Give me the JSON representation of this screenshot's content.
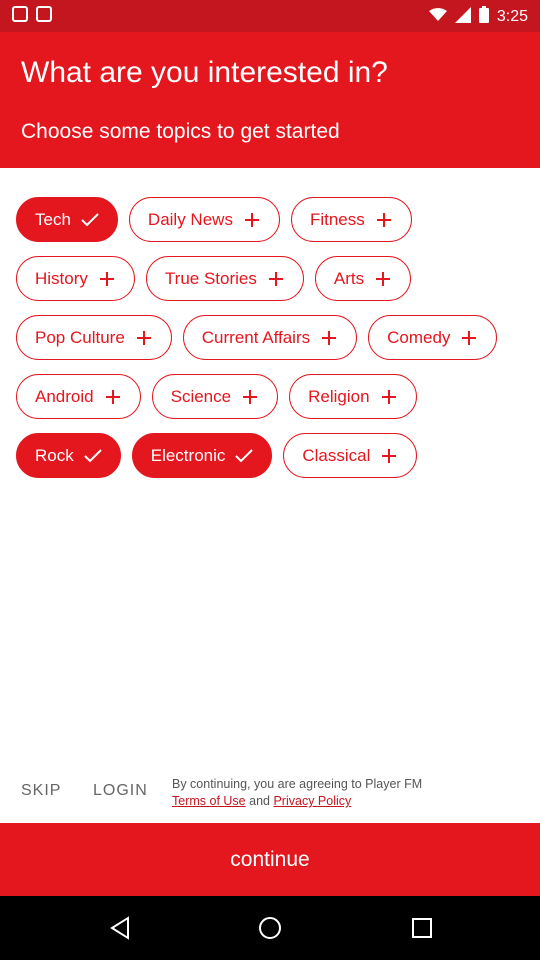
{
  "status": {
    "time": "3:25"
  },
  "header": {
    "title": "What are you interested in?",
    "subtitle": "Choose some topics to get started"
  },
  "topics": [
    [
      {
        "label": "Tech",
        "selected": true
      },
      {
        "label": "Daily News",
        "selected": false
      },
      {
        "label": "Fitness",
        "selected": false
      }
    ],
    [
      {
        "label": "History",
        "selected": false
      },
      {
        "label": "True Stories",
        "selected": false
      },
      {
        "label": "Arts",
        "selected": false
      }
    ],
    [
      {
        "label": "Pop Culture",
        "selected": false
      },
      {
        "label": "Current Affairs",
        "selected": false
      },
      {
        "label": "Comedy",
        "selected": false
      }
    ],
    [
      {
        "label": "Android",
        "selected": false
      },
      {
        "label": "Science",
        "selected": false
      },
      {
        "label": "Religion",
        "selected": false
      }
    ],
    [
      {
        "label": "Rock",
        "selected": true
      },
      {
        "label": "Electronic",
        "selected": true
      },
      {
        "label": "Classical",
        "selected": false
      }
    ]
  ],
  "footer": {
    "skip_label": "SKIP",
    "login_label": "LOGIN",
    "terms_prefix": "By continuing, you are agreeing to Player FM",
    "terms_link": "Terms of Use",
    "terms_and": "and",
    "privacy_link": "Privacy Policy"
  },
  "continue_label": "continue",
  "colors": {
    "accent": "#e4161e",
    "statusbar": "#c4161f"
  }
}
